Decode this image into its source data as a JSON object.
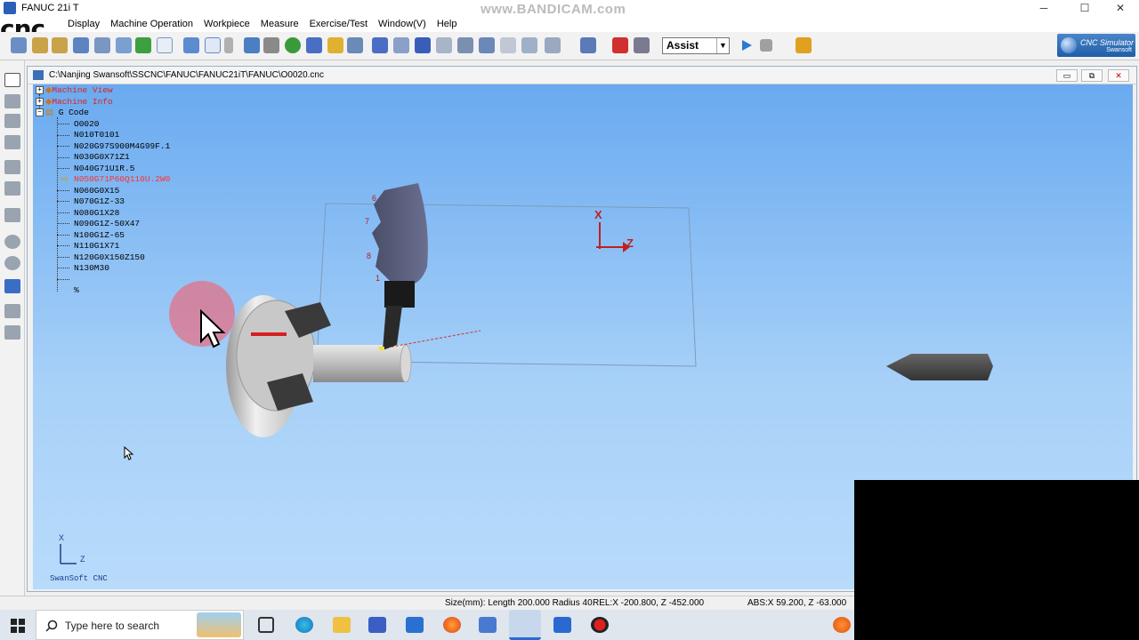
{
  "window": {
    "title": "FANUC 21i T",
    "watermark": "www.BANDICAM.com",
    "minimize": "─",
    "maximize": "☐",
    "close": "✕"
  },
  "logo": {
    "text": "cnc"
  },
  "menu": [
    "Display",
    "Machine Operation",
    "Workpiece",
    "Measure",
    "Exercise/Test",
    "Window(V)",
    "Help"
  ],
  "toolbar": {
    "mode_select": "Assist",
    "mode_arrow": "▼",
    "brand_line1": "CNC Simulator",
    "brand_line2": "Swansoft"
  },
  "document": {
    "path": "C:\\Nanjing Swansoft\\SSCNC\\FANUC\\FANUC21iT\\FANUC\\O0020.cnc",
    "min": "▭",
    "restore": "⧉",
    "close": "✕"
  },
  "tree": {
    "nodes": [
      {
        "label": "Machine View",
        "expander": "+"
      },
      {
        "label": "Machine Info",
        "expander": "+"
      },
      {
        "label": "G Code",
        "expander": "−"
      }
    ],
    "gcode": [
      "O0020",
      "N010T0101",
      "N020G97S900M4G99F.1",
      "N030G0X71Z1",
      "N040G71U1R.5",
      "N050G71P60Q110U.2W0",
      "N060G0X15",
      "N070G1Z-33",
      "N080G1X28",
      "N090G1Z-50X47",
      "N100G1Z-65",
      "N110G1X71",
      "N120G0X150Z150",
      "N130M30",
      "",
      "%"
    ],
    "current_index": 5
  },
  "viewport": {
    "axis_x": "X",
    "axis_z": "Z",
    "turret_labels": [
      "6",
      "7",
      "8",
      "1"
    ],
    "footer": "SwanSoft CNC",
    "corner_axis_x": "X",
    "corner_axis_z": "Z"
  },
  "status": {
    "size": "Size(mm): Length 200.000 Radius  40.",
    "rel": "REL:X -200.800, Z -452.000",
    "abs": "ABS:X   59.200, Z -63.000"
  },
  "taskbar": {
    "search_placeholder": "Type here to search"
  }
}
